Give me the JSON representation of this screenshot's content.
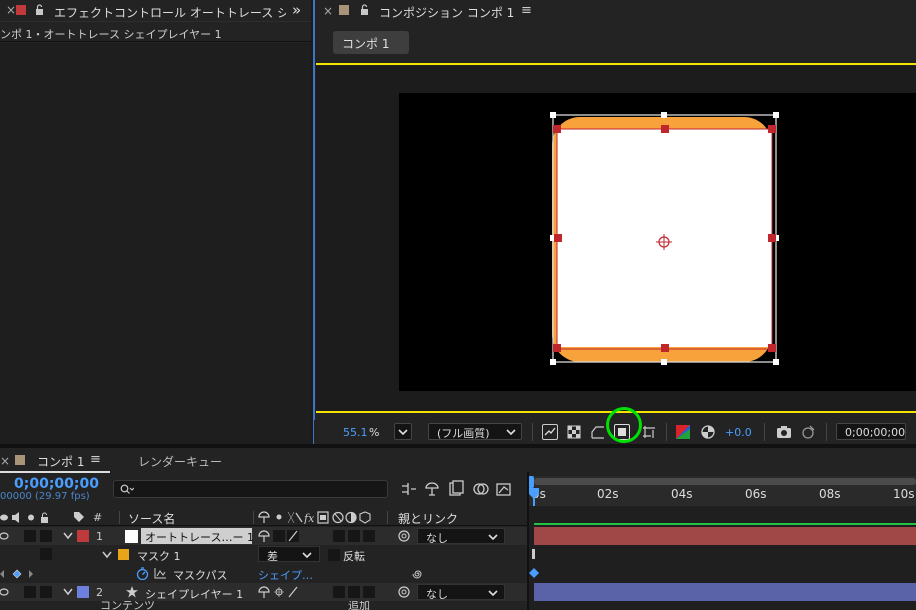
{
  "effects_panel": {
    "close_glyph": "×",
    "tab_title": "エフェクトコントロール オートトレース シ",
    "overflow_glyph": "»",
    "subtitle": "ンポ 1・オートトレース シェイプレイヤー 1"
  },
  "comp_panel": {
    "close_glyph": "×",
    "tab_title": "コンポジション コンポ 1",
    "menu_glyph": "≡",
    "comp_button": "コンポ 1"
  },
  "viewer_toolbar": {
    "zoom_value": "55.1",
    "zoom_unit": "%",
    "quality": "(フル画質)",
    "exposure": "+0.0",
    "timecode": "0;00;00;00"
  },
  "timeline": {
    "close_glyph": "×",
    "tab_title": "コンポ 1",
    "menu_glyph": "≡",
    "render_queue_tab": "レンダーキュー",
    "current_time": "0;00;00;00",
    "frame_info": "00000 (29.97 fps)",
    "search_placeholder": "",
    "ruler_labels": [
      "0s",
      "02s",
      "04s",
      "06s",
      "08s",
      "10s"
    ],
    "columns": {
      "number": "#",
      "source_name": "ソース名",
      "parent_link": "親とリンク"
    },
    "layers": [
      {
        "number": "1",
        "name": "オートトレース…ー 1",
        "parent": "なし",
        "label_color": "#c0393b"
      },
      {
        "number": "2",
        "name": "シェイプレイヤー 1",
        "parent": "なし",
        "label_color": "#6f7fe0"
      }
    ],
    "mask": {
      "name": "マスク 1",
      "mode": "差",
      "invert_label": "反転",
      "path_label": "マスクパス",
      "path_value": "シェイプ…",
      "label_color": "#e8a51a"
    },
    "bottom_row_partial": "コンテンツ",
    "bottom_row_right": "追加"
  },
  "colors": {
    "accent_yellow": "#f2e300",
    "timecode_blue": "#4a9eff",
    "highlight_circle": "#00e000",
    "shape_orange": "#f7a23a",
    "handle_red": "#c0272d",
    "layer1_bar": "#a04747",
    "layer2_bar": "#5a62a8"
  }
}
